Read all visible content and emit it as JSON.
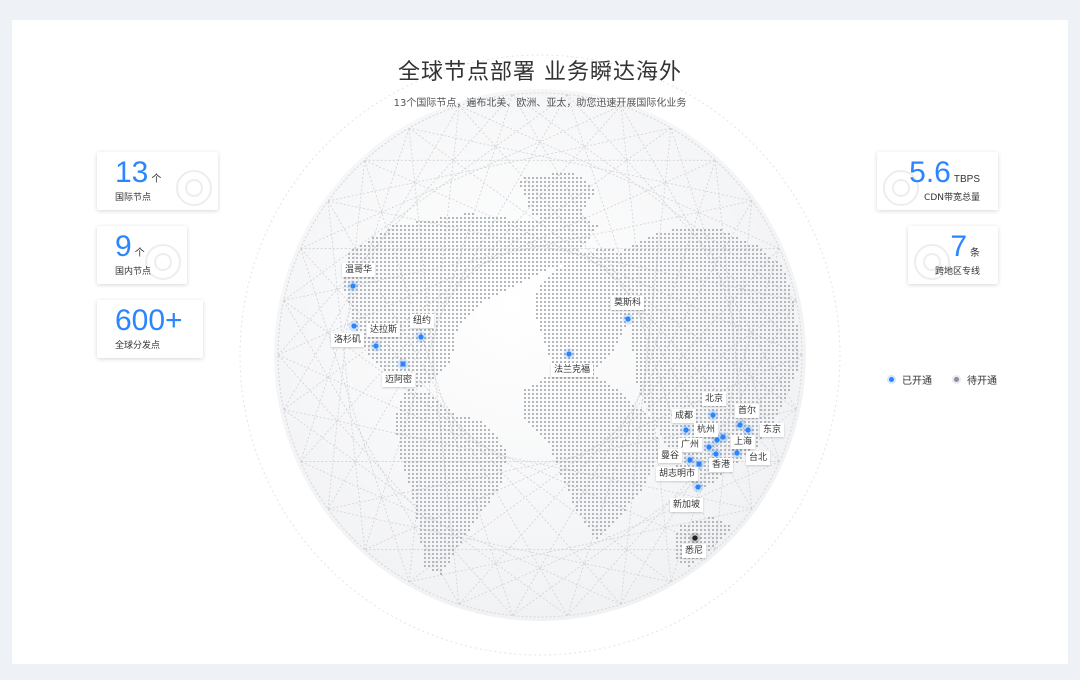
{
  "header": {
    "title": "全球节点部署 业务瞬达海外",
    "subtitle": "13个国际节点，遍布北美、欧洲、亚太，助您迅速开展国际化业务"
  },
  "stats_left": [
    {
      "value": "13",
      "unit": "个",
      "label": "国际节点"
    },
    {
      "value": "9",
      "unit": "个",
      "label": "国内节点"
    },
    {
      "value": "600+",
      "unit": "",
      "label": "全球分发点"
    }
  ],
  "stats_right": [
    {
      "value": "5.6",
      "unit": "TBPS",
      "label": "CDN带宽总量"
    },
    {
      "value": "7",
      "unit": "条",
      "label": "跨地区专线"
    }
  ],
  "legend": {
    "open": "已开通",
    "pending": "待开通",
    "open_color": "#2a85ff",
    "pending_color": "#8a8f99"
  },
  "cities": [
    {
      "name": "温哥华",
      "status": "open"
    },
    {
      "name": "纽约",
      "status": "open"
    },
    {
      "name": "达拉斯",
      "status": "open"
    },
    {
      "name": "洛杉矶",
      "status": "open"
    },
    {
      "name": "迈阿密",
      "status": "open"
    },
    {
      "name": "莫斯科",
      "status": "open"
    },
    {
      "name": "法兰克福",
      "status": "open"
    },
    {
      "name": "北京",
      "status": "open"
    },
    {
      "name": "首尔",
      "status": "open"
    },
    {
      "name": "成都",
      "status": "open"
    },
    {
      "name": "杭州",
      "status": "open"
    },
    {
      "name": "东京",
      "status": "open"
    },
    {
      "name": "广州",
      "status": "open"
    },
    {
      "name": "上海",
      "status": "open"
    },
    {
      "name": "曼谷",
      "status": "open"
    },
    {
      "name": "台北",
      "status": "open"
    },
    {
      "name": "香港",
      "status": "open"
    },
    {
      "name": "胡志明市",
      "status": "open"
    },
    {
      "name": "新加坡",
      "status": "open"
    },
    {
      "name": "悉尼",
      "status": "pending"
    }
  ]
}
